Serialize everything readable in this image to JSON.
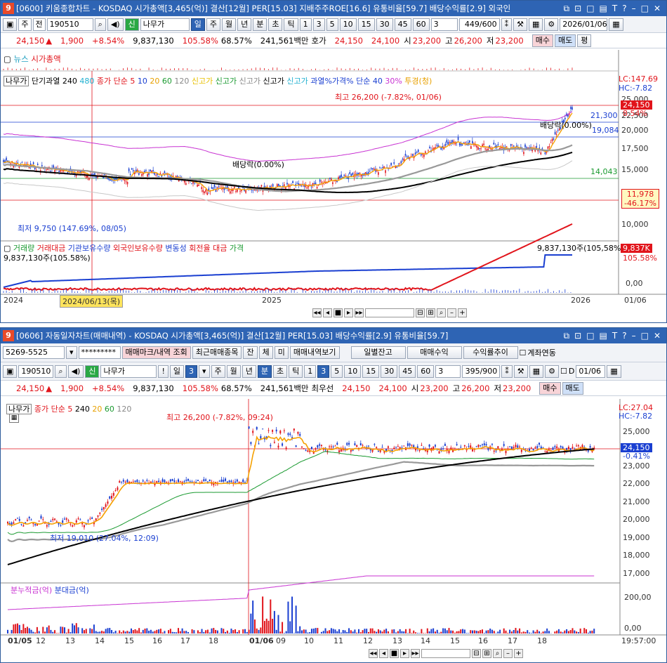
{
  "win1": {
    "title": "[0600] 키움종합차트 - KOSDAQ 시가총액[3,465(억)] 결산[12월] PER[15.03] 지배주주ROE[16.6] 유통비율[59.7] 배당수익률[2.9] 외국인",
    "toolbar": {
      "market": "주",
      "scope": "전",
      "code": "190510",
      "name": "나무가",
      "periods": [
        "일",
        "주",
        "월",
        "년",
        "분",
        "초",
        "틱"
      ],
      "numbers": [
        "1",
        "3",
        "5",
        "10",
        "15",
        "30",
        "45",
        "60"
      ],
      "count_sel": "3",
      "page_count": "449/600",
      "date": "2026/01/06"
    },
    "quote": {
      "price": "24,150",
      "change": "1,900",
      "change_pct": "+8.54%",
      "volume": "9,837,130",
      "vol_ratio": "105.58%",
      "turnover": "68.57%",
      "amount": "241,561백만",
      "ask_label": "호가",
      "ask": "24,150",
      "bid": "24,100",
      "open_label": "시",
      "open": "23,200",
      "high_label": "고",
      "high": "26,200",
      "low_label": "저",
      "low": "23,200",
      "buy": "매수",
      "sell": "매도",
      "eval": "평"
    },
    "news_legend": [
      "뉴스",
      "시가총액"
    ],
    "price_legend": [
      "나무가",
      "단기과열",
      "240",
      "480",
      "종가 단순 5",
      "10",
      "20",
      "60",
      "120",
      "신고가",
      "신고가",
      "신고가",
      "신고가",
      "신고가",
      "과열%가격% 단순 40",
      "30%",
      "투경(청)"
    ],
    "price_axis": [
      "25,000",
      "22,500",
      "20,000",
      "17,500",
      "15,000",
      "12,500",
      "10,000"
    ],
    "annotations": {
      "high": "최고 26,200 (-7.82%, 01/06)",
      "low": "최저 9,750 (147.69%, 08/05)",
      "dividend1": "배당락(0.00%)",
      "dividend2": "배당락(0.00%)",
      "l21300": "21,300",
      "l19084": "19,084",
      "l14043": "14,043",
      "lc": "LC:147.69",
      "hc": "HC:-7.82",
      "cur": "24,150",
      "cur_pct": "8.54%",
      "ma": "11,978",
      "ma_pct": "-46.17%"
    },
    "vol_legend": [
      "거래량",
      "거래대금",
      "기관보유수량",
      "외국인보유수량",
      "변동성",
      "회전율",
      "대금",
      "가격"
    ],
    "vol_annot": "9,837,130주(105,58%)",
    "vol_annot_left": "9,837,130주(105.58%)",
    "vol_tag": "9,837K",
    "vol_pct": "105.58%",
    "vol_zero": "0,00",
    "dates": [
      "2024",
      "2024/06/13(목)",
      "2025",
      "2026"
    ],
    "corner": "01/06"
  },
  "win2": {
    "title": "[0606] 자동일자차트(매매내역) - KOSDAQ 시가총액[3,465(억)] 결산[12월] PER[15.03] 배당수익률[2.9] 유통비율[59.7]",
    "toolbar1": {
      "account": "5269-5525",
      "password": "*********",
      "btn_trade": "매매마크/내역 조회",
      "btn_recent": "최근매매종목",
      "btn_jan": "잔",
      "btn_che": "체",
      "btn_mi": "미",
      "btn_history": "매매내역보기",
      "btn_daily": "일별잔고",
      "btn_profit": "매매수익",
      "btn_trend": "수익률추이",
      "chk_link": "계좌연동"
    },
    "toolbar2": {
      "code": "190510",
      "name": "나무가",
      "period_sel": "일",
      "interval": "3",
      "periods": [
        "주",
        "월",
        "년",
        "분",
        "초",
        "틱"
      ],
      "numbers": [
        "1",
        "3",
        "5",
        "10",
        "15",
        "30",
        "45",
        "60"
      ],
      "count_sel": "3",
      "page_count": "395/900",
      "d_label": "D",
      "date": "01/06"
    },
    "quote": {
      "price": "24,150",
      "change": "1,900",
      "change_pct": "+8.54%",
      "volume": "9,837,130",
      "vol_ratio": "105.58%",
      "turnover": "68.57%",
      "amount": "241,561백만",
      "ask_label": "최우선",
      "ask": "24,150",
      "bid": "24,100",
      "open_label": "시",
      "open": "23,200",
      "high_label": "고",
      "high": "26,200",
      "low_label": "저",
      "low": "23,200",
      "buy": "매수",
      "sell": "매도"
    },
    "price_legend": [
      "나무가",
      "종가 단순 5",
      "240",
      "20",
      "60",
      "120"
    ],
    "price_axis": [
      "25,000",
      "24,000",
      "23,000",
      "22,000",
      "21,000",
      "20,000",
      "19,000",
      "18,000",
      "17,000"
    ],
    "annotations": {
      "high": "최고 26,200 (-7.82%, 09:24)",
      "low": "최저 19,010 (27.04%, 12:09)",
      "lc": "LC:27.04",
      "hc": "HC:-7.82",
      "cur": "24,150",
      "cur_pct": "-0.41%"
    },
    "vol_legend": [
      "분누적금(억)",
      "분대금(억)"
    ],
    "vol_axis": "200,00",
    "vol_zero": "0,00",
    "times": [
      "01/05",
      "12",
      "13",
      "14",
      "15",
      "16",
      "17",
      "18",
      "01/06",
      "09",
      "10",
      "11",
      "12",
      "13",
      "14",
      "15",
      "16",
      "17",
      "18"
    ],
    "clock": "19:57:00"
  },
  "colors": {
    "titlebar": "#2e64b4",
    "up": "#e1141b",
    "down": "#1a3fd1",
    "ma5": "#f5a000",
    "ma240": "#000000",
    "ma120": "#999999",
    "envelope": "#c832d2"
  }
}
